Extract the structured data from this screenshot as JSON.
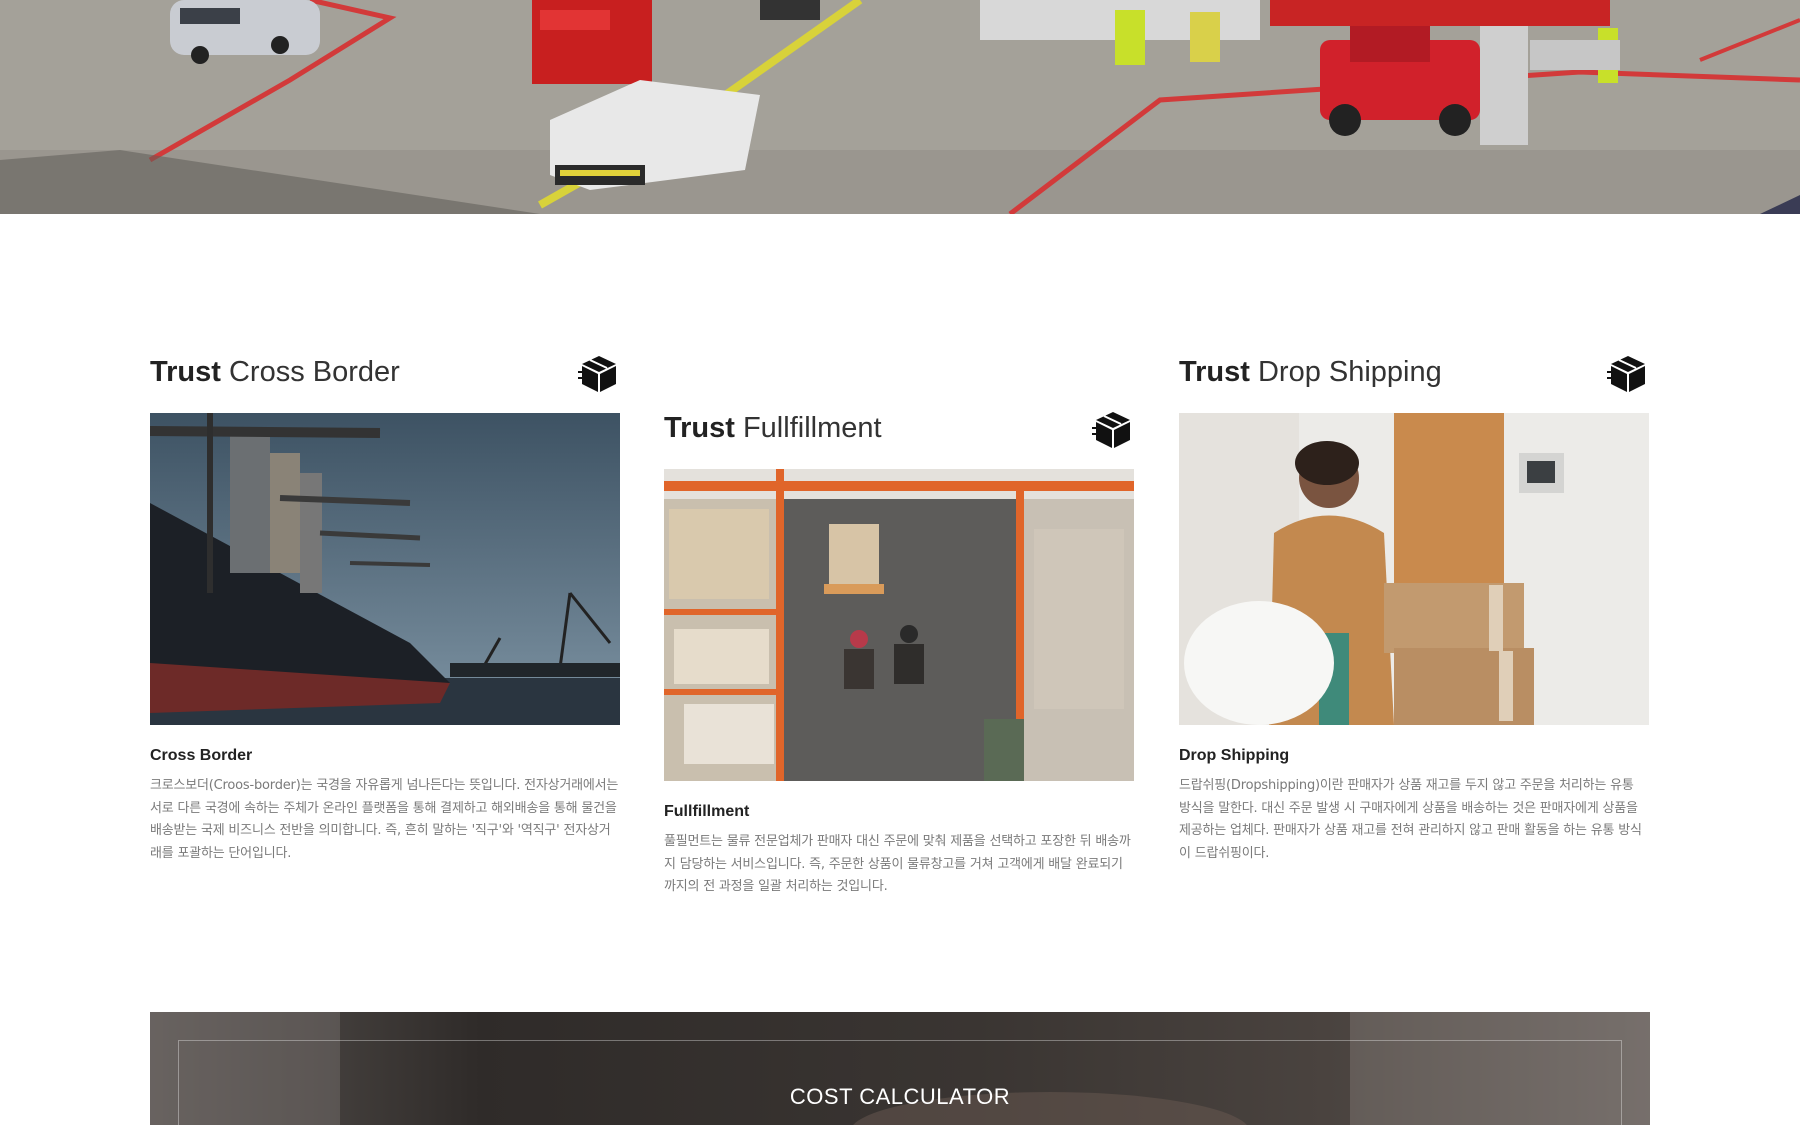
{
  "hero": {
    "image": "airport-ground-vehicles-photo"
  },
  "cards": [
    {
      "title_strong": "Trust",
      "title_light": "Cross Border",
      "icon": "box-icon",
      "image": "cargo-ship-port-photo",
      "subtitle": "Cross Border",
      "description": "크로스보더(Croos-border)는 국경을 자유롭게 넘나든다는 뜻입니다. 전자상거래에서는 서로 다른 국경에 속하는 주체가 온라인 플랫폼을 통해 결제하고 해외배송을 통해 물건을 배송받는 국제 비즈니스 전반을 의미합니다. 즉, 흔히 말하는 '직구'와 '역직구' 전자상거래를 포괄하는 단어입니다."
    },
    {
      "title_strong": "Trust",
      "title_light": "Fullfillment",
      "icon": "box-icon",
      "image": "warehouse-aisle-photo",
      "subtitle": "Fullfillment",
      "description": "풀필먼트는 물류 전문업체가 판매자 대신 주문에 맞춰 제품을 선택하고 포장한 뒤 배송까지 담당하는 서비스입니다. 즉, 주문한 상품이 물류창고를 거쳐 고객에게 배달 완료되기까지의 전 과정을 일괄 처리하는 것입니다."
    },
    {
      "title_strong": "Trust",
      "title_light": "Drop Shipping",
      "icon": "box-icon",
      "image": "woman-carrying-boxes-photo",
      "subtitle": "Drop Shipping",
      "description": "드랍쉬핑(Dropshipping)이란 판매자가 상품 재고를 두지 않고 주문을 처리하는 유통 방식을 말한다. 대신 주문 발생 시 구매자에게 상품을 배송하는 것은 판매자에게 상품을 제공하는 업체다. 판매자가 상품 재고를 전혀 관리하지 않고 판매 활동을 하는 유통 방식이 드랍쉬핑이다."
    }
  ],
  "calculator": {
    "title": "COST CALCULATOR"
  }
}
